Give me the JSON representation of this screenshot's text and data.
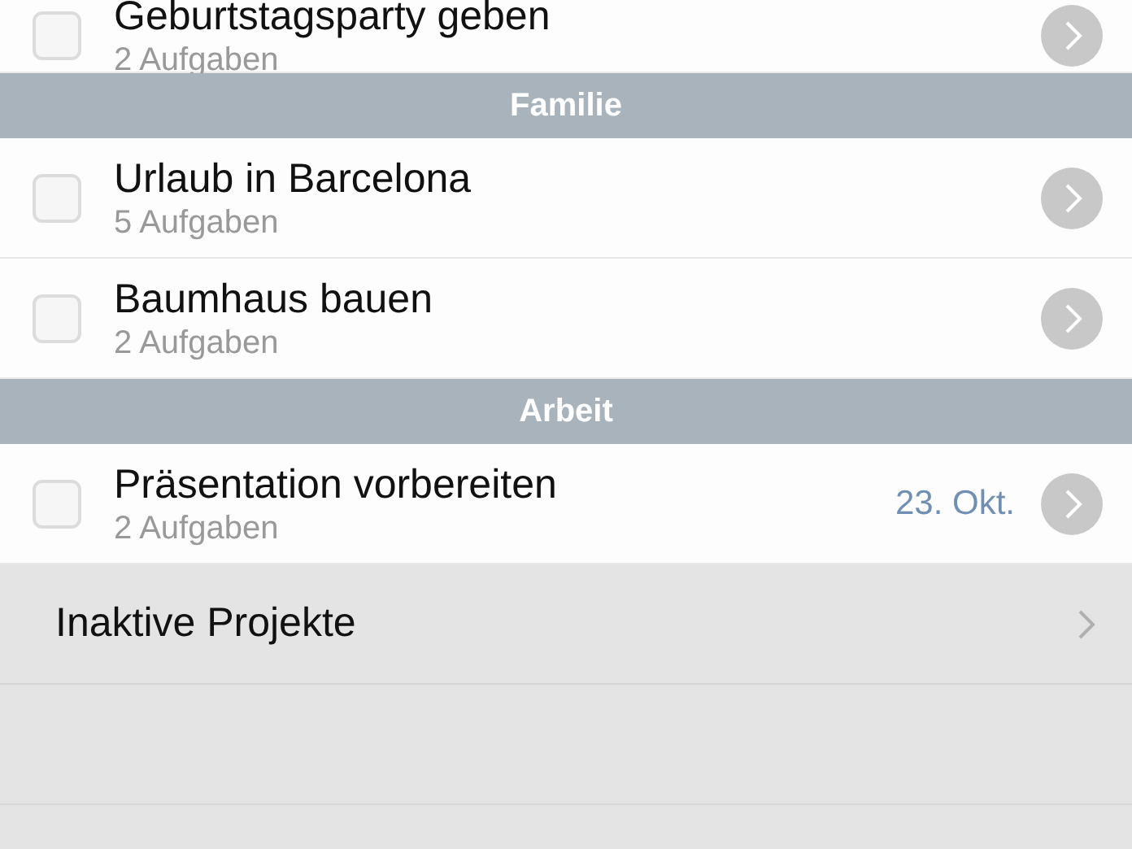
{
  "sections": [
    {
      "projects": [
        {
          "title": "Geburtstagsparty geben",
          "subtitle": "2 Aufgaben",
          "checked": false
        }
      ]
    },
    {
      "header": "Familie",
      "projects": [
        {
          "title": "Urlaub in Barcelona",
          "subtitle": "5 Aufgaben",
          "checked": false
        },
        {
          "title": "Baumhaus bauen",
          "subtitle": "2 Aufgaben",
          "checked": false
        }
      ]
    },
    {
      "header": "Arbeit",
      "projects": [
        {
          "title": "Präsentation vorbereiten",
          "subtitle": "2 Aufgaben",
          "checked": false,
          "due": "23. Okt."
        }
      ]
    }
  ],
  "footer_items": [
    {
      "label": "Inaktive Projekte"
    }
  ]
}
